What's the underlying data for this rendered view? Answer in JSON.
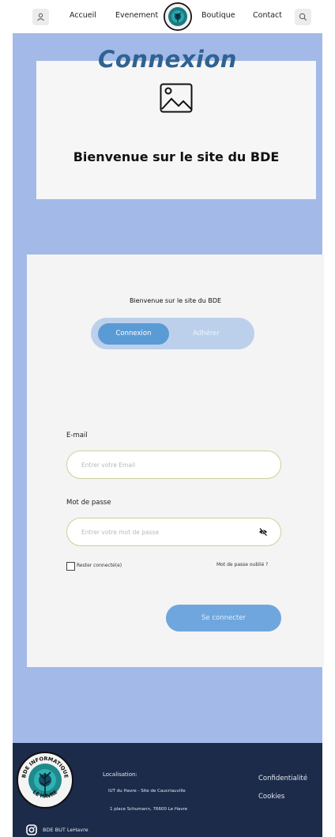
{
  "header": {
    "nav": [
      "Accueil",
      "Evenement",
      "Boutique",
      "Contact"
    ],
    "icons": {
      "left": "user-icon",
      "right": "search-icon",
      "center": "bde-logo"
    }
  },
  "welcome_card": {
    "title": "Connexion",
    "image_icon": "image-placeholder-icon",
    "text": "Bienvenue sur le site du BDE"
  },
  "login_card": {
    "welcome": "Bienvenue sur le site du BDE",
    "tabs": {
      "active": "Connexion",
      "inactive": "Adhérer"
    },
    "email": {
      "label": "E-mail",
      "placeholder": "Entrer votre Email",
      "value": ""
    },
    "password": {
      "label": "Mot de passe",
      "placeholder": "Entrer votre mot de passe",
      "value": "",
      "toggle_icon": "eye-off-icon"
    },
    "remember": {
      "label": "Rester connecté(e)",
      "checked": false
    },
    "forgot": "Mot de passe oublié ?",
    "submit": "Se connecter"
  },
  "footer": {
    "logo_top_text": "BDE INFORMATIQUE",
    "logo_bottom_text": "LE HAVRE",
    "location_title": "Localisation:",
    "location_line1": "IUT du Havre - Site de Caucriauville",
    "location_line2": "1 place Schumann, 76600 Le Havre",
    "links": [
      "Confidentialité",
      "Cookies"
    ],
    "social": {
      "icon": "instagram-icon",
      "label": "BDE BUT LeHavre"
    }
  },
  "colors": {
    "page_bg": "#a3b9e8",
    "title": "#2f6290",
    "accent_button": "#5b9bd5",
    "footer_bg": "#1c2b4a"
  }
}
